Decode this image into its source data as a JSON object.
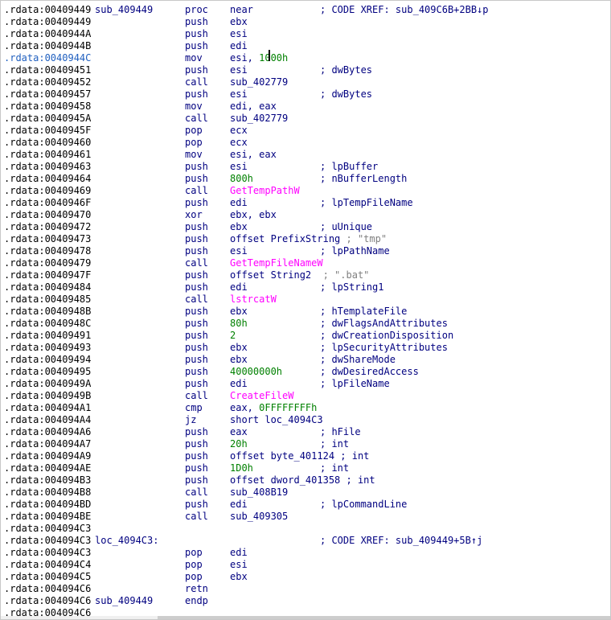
{
  "listing": {
    "lines": [
      {
        "addr": ".rdata:00409449",
        "label": "sub_409449",
        "mn": "proc",
        "op": [
          {
            "t": "near"
          }
        ],
        "cmt": "; CODE XREF: sub_409C6B+2BB↓p"
      },
      {
        "addr": ".rdata:00409449",
        "mn": "push",
        "op": [
          {
            "t": "ebx"
          }
        ]
      },
      {
        "addr": ".rdata:0040944A",
        "mn": "push",
        "op": [
          {
            "t": "esi"
          }
        ]
      },
      {
        "addr": ".rdata:0040944B",
        "mn": "push",
        "op": [
          {
            "t": "edi"
          }
        ]
      },
      {
        "addr": ".rdata:0040944C",
        "hl": true,
        "mn": "mov",
        "op": [
          {
            "t": "esi, "
          },
          {
            "t": "1000h",
            "c": "num"
          }
        ]
      },
      {
        "addr": ".rdata:00409451",
        "mn": "push",
        "op": [
          {
            "t": "esi"
          }
        ],
        "cmt": "; dwBytes"
      },
      {
        "addr": ".rdata:00409452",
        "mn": "call",
        "op": [
          {
            "t": "sub_402779"
          }
        ]
      },
      {
        "addr": ".rdata:00409457",
        "mn": "push",
        "op": [
          {
            "t": "esi"
          }
        ],
        "cmt": "; dwBytes"
      },
      {
        "addr": ".rdata:00409458",
        "mn": "mov",
        "op": [
          {
            "t": "edi, eax"
          }
        ]
      },
      {
        "addr": ".rdata:0040945A",
        "mn": "call",
        "op": [
          {
            "t": "sub_402779"
          }
        ]
      },
      {
        "addr": ".rdata:0040945F",
        "mn": "pop",
        "op": [
          {
            "t": "ecx"
          }
        ]
      },
      {
        "addr": ".rdata:00409460",
        "mn": "pop",
        "op": [
          {
            "t": "ecx"
          }
        ]
      },
      {
        "addr": ".rdata:00409461",
        "mn": "mov",
        "op": [
          {
            "t": "esi, eax"
          }
        ]
      },
      {
        "addr": ".rdata:00409463",
        "mn": "push",
        "op": [
          {
            "t": "esi"
          }
        ],
        "cmt": "; lpBuffer"
      },
      {
        "addr": ".rdata:00409464",
        "mn": "push",
        "op": [
          {
            "t": "800h",
            "c": "num"
          }
        ],
        "cmt": "; nBufferLength"
      },
      {
        "addr": ".rdata:00409469",
        "mn": "call",
        "op": [
          {
            "t": "GetTempPathW",
            "c": "api"
          }
        ]
      },
      {
        "addr": ".rdata:0040946F",
        "mn": "push",
        "op": [
          {
            "t": "edi"
          }
        ],
        "cmt": "; lpTempFileName"
      },
      {
        "addr": ".rdata:00409470",
        "mn": "xor",
        "op": [
          {
            "t": "ebx, ebx"
          }
        ]
      },
      {
        "addr": ".rdata:00409472",
        "mn": "push",
        "op": [
          {
            "t": "ebx"
          }
        ],
        "cmt": "; uUnique"
      },
      {
        "addr": ".rdata:00409473",
        "mn": "push",
        "op": [
          {
            "t": "offset PrefixString "
          },
          {
            "t": "; ",
            "c": "dim"
          },
          {
            "t": "\"tmp\"",
            "c": "str"
          }
        ]
      },
      {
        "addr": ".rdata:00409478",
        "mn": "push",
        "op": [
          {
            "t": "esi"
          }
        ],
        "cmt": "; lpPathName"
      },
      {
        "addr": ".rdata:00409479",
        "mn": "call",
        "op": [
          {
            "t": "GetTempFileNameW",
            "c": "api"
          }
        ]
      },
      {
        "addr": ".rdata:0040947F",
        "mn": "push",
        "op": [
          {
            "t": "offset String2  "
          },
          {
            "t": "; ",
            "c": "dim"
          },
          {
            "t": "\".bat\"",
            "c": "str"
          }
        ]
      },
      {
        "addr": ".rdata:00409484",
        "mn": "push",
        "op": [
          {
            "t": "edi"
          }
        ],
        "cmt": "; lpString1"
      },
      {
        "addr": ".rdata:00409485",
        "mn": "call",
        "op": [
          {
            "t": "lstrcatW",
            "c": "api"
          }
        ]
      },
      {
        "addr": ".rdata:0040948B",
        "mn": "push",
        "op": [
          {
            "t": "ebx"
          }
        ],
        "cmt": "; hTemplateFile"
      },
      {
        "addr": ".rdata:0040948C",
        "mn": "push",
        "op": [
          {
            "t": "80h",
            "c": "num"
          }
        ],
        "cmt": "; dwFlagsAndAttributes"
      },
      {
        "addr": ".rdata:00409491",
        "mn": "push",
        "op": [
          {
            "t": "2",
            "c": "num"
          }
        ],
        "cmt": "; dwCreationDisposition"
      },
      {
        "addr": ".rdata:00409493",
        "mn": "push",
        "op": [
          {
            "t": "ebx"
          }
        ],
        "cmt": "; lpSecurityAttributes"
      },
      {
        "addr": ".rdata:00409494",
        "mn": "push",
        "op": [
          {
            "t": "ebx"
          }
        ],
        "cmt": "; dwShareMode"
      },
      {
        "addr": ".rdata:00409495",
        "mn": "push",
        "op": [
          {
            "t": "40000000h",
            "c": "num"
          }
        ],
        "cmt": "; dwDesiredAccess"
      },
      {
        "addr": ".rdata:0040949A",
        "mn": "push",
        "op": [
          {
            "t": "edi"
          }
        ],
        "cmt": "; lpFileName"
      },
      {
        "addr": ".rdata:0040949B",
        "mn": "call",
        "op": [
          {
            "t": "CreateFileW",
            "c": "api"
          }
        ]
      },
      {
        "addr": ".rdata:004094A1",
        "mn": "cmp",
        "op": [
          {
            "t": "eax, "
          },
          {
            "t": "0FFFFFFFFh",
            "c": "num"
          }
        ]
      },
      {
        "addr": ".rdata:004094A4",
        "mn": "jz",
        "op": [
          {
            "t": "short loc_4094C3"
          }
        ]
      },
      {
        "addr": ".rdata:004094A6",
        "mn": "push",
        "op": [
          {
            "t": "eax"
          }
        ],
        "cmt": "; hFile"
      },
      {
        "addr": ".rdata:004094A7",
        "mn": "push",
        "op": [
          {
            "t": "20h",
            "c": "num"
          }
        ],
        "cmt": "; int"
      },
      {
        "addr": ".rdata:004094A9",
        "mn": "push",
        "op": [
          {
            "t": "offset byte_401124 ; int"
          }
        ]
      },
      {
        "addr": ".rdata:004094AE",
        "mn": "push",
        "op": [
          {
            "t": "1D0h",
            "c": "num"
          }
        ],
        "cmt": "; int"
      },
      {
        "addr": ".rdata:004094B3",
        "mn": "push",
        "op": [
          {
            "t": "offset dword_401358 ; int"
          }
        ]
      },
      {
        "addr": ".rdata:004094B8",
        "mn": "call",
        "op": [
          {
            "t": "sub_408B19"
          }
        ]
      },
      {
        "addr": ".rdata:004094BD",
        "mn": "push",
        "op": [
          {
            "t": "edi"
          }
        ],
        "cmt": "; lpCommandLine"
      },
      {
        "addr": ".rdata:004094BE",
        "mn": "call",
        "op": [
          {
            "t": "sub_409305"
          }
        ]
      },
      {
        "addr": ".rdata:004094C3"
      },
      {
        "addr": ".rdata:004094C3",
        "label": "loc_4094C3:",
        "cmt": "; CODE XREF: sub_409449+5B↑j"
      },
      {
        "addr": ".rdata:004094C3",
        "mn": "pop",
        "op": [
          {
            "t": "edi"
          }
        ]
      },
      {
        "addr": ".rdata:004094C4",
        "mn": "pop",
        "op": [
          {
            "t": "esi"
          }
        ]
      },
      {
        "addr": ".rdata:004094C5",
        "mn": "pop",
        "op": [
          {
            "t": "ebx"
          }
        ]
      },
      {
        "addr": ".rdata:004094C6",
        "mn": "retn"
      },
      {
        "addr": ".rdata:004094C6",
        "label": "sub_409449",
        "mn": "endp"
      },
      {
        "addr": ".rdata:004094C6"
      }
    ]
  },
  "colors": {
    "address": "#000000",
    "address_highlight": "#1f5fbf",
    "code": "#000080",
    "number": "#008000",
    "api": "#ff00ff",
    "string_comment": "#808080"
  }
}
